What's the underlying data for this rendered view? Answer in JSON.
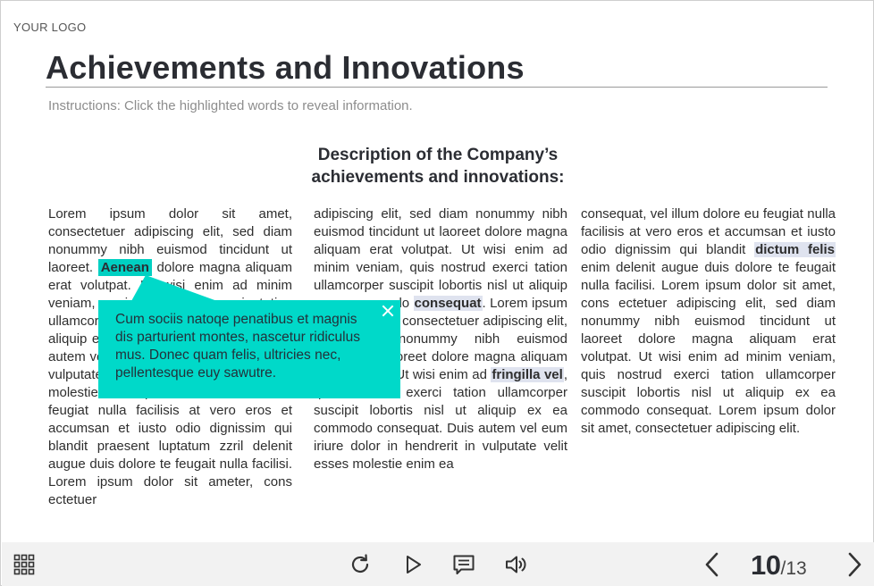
{
  "header": {
    "logo_text": "YOUR LOGO",
    "title": "Achievements and Innovations",
    "instructions": "Instructions: Click the highlighted words to reveal information."
  },
  "content": {
    "heading_line1": "Description of the Company’s",
    "heading_line2": "achievements and innovations:",
    "col1": {
      "t1": "Lorem ipsum dolor sit amet, consectetuer adipiscing elit, sed diam nonummy nibh euismod tincidunt ut laoreet. ",
      "hl": "Aenean",
      "t2": " dolore magna aliquam erat volutpat. Ut wisi enim ad minim veniam, quis nostrud exerci tation ullamcorper suscipit lobortis nisl ut aliquip ex ea commodo consequat. Duis autem vel eum iriure dolor in hendrerit in vulputate velit esse ",
      "hl2": "pellentesque",
      "t3": " molestie consequat, vel illum dolore eu feugiat nulla facilisis at vero eros et accumsan et iusto odio dignissim qui blandit praesent luptatum zzril delenit augue duis dolore te feugait nulla facilisi. Lorem ipsum dolor  sit ameter, cons ectetuer"
    },
    "col2": {
      "t1": "adipiscing elit, sed diam nonummy nibh euismod tincidunt ut laoreet dolore magna aliquam erat volutpat. Ut wisi enim ad minim veniam, quis nostrud exerci tation ullamcorper suscipit lobortis nisl ut aliquip ex ea commodo ",
      "hl": "consequat",
      "t2": ". Lorem ipsum dolor sit amet, consectetuer adipiscing elit, sed diam nonummy nibh euismod tincidunt ut laoreet dolore magna aliquam erat volutpat. Ut wisi enim ad ",
      "hl2": "fringilla vel",
      "t3": ", quis nostrud exerci tation ullamcorper suscipit lobortis nisl ut aliquip ex ea commodo consequat. Duis autem vel eum iriure dolor in hendrerit in vulputate velit  esses molestie enim ea"
    },
    "col3": {
      "t1": "consequat, vel illum dolore eu feugiat nulla facilisis at vero eros et accumsan et iusto odio dignissim qui blandit ",
      "hl": "dictum felis",
      "t2": " enim delenit augue duis dolore te feugait nulla facilisi. Lorem ipsum dolor sit amet, cons ectetuer adipiscing elit, sed diam nonummy nibh euismod tincidunt ut laoreet dolore magna aliquam erat volutpat. Ut wisi enim ad minim veniam, quis nostrud exerci tation ullamcorper suscipit lobortis nisl ut aliquip ex ea commodo consequat. Lorem ipsum dolor sit amet, consectetuer adipiscing elit."
    }
  },
  "tooltip": {
    "text": "Cum sociis natoqe penatibus et magnis dis parturient montes, nascetur ridiculus mus. Donec quam felis, ultricies nec, pellentesque euy sawutre."
  },
  "footer": {
    "page_current": "10",
    "page_total": "/13",
    "icons": [
      "grid-menu-icon",
      "replay-icon",
      "play-icon",
      "notes-icon",
      "volume-icon",
      "prev-arrow-icon",
      "next-arrow-icon"
    ]
  },
  "colors": {
    "accent": "#00d9c9",
    "highlight": "#dfe3ef",
    "toolbar_bg": "#f2f2f2",
    "text": "#2b2d33"
  }
}
